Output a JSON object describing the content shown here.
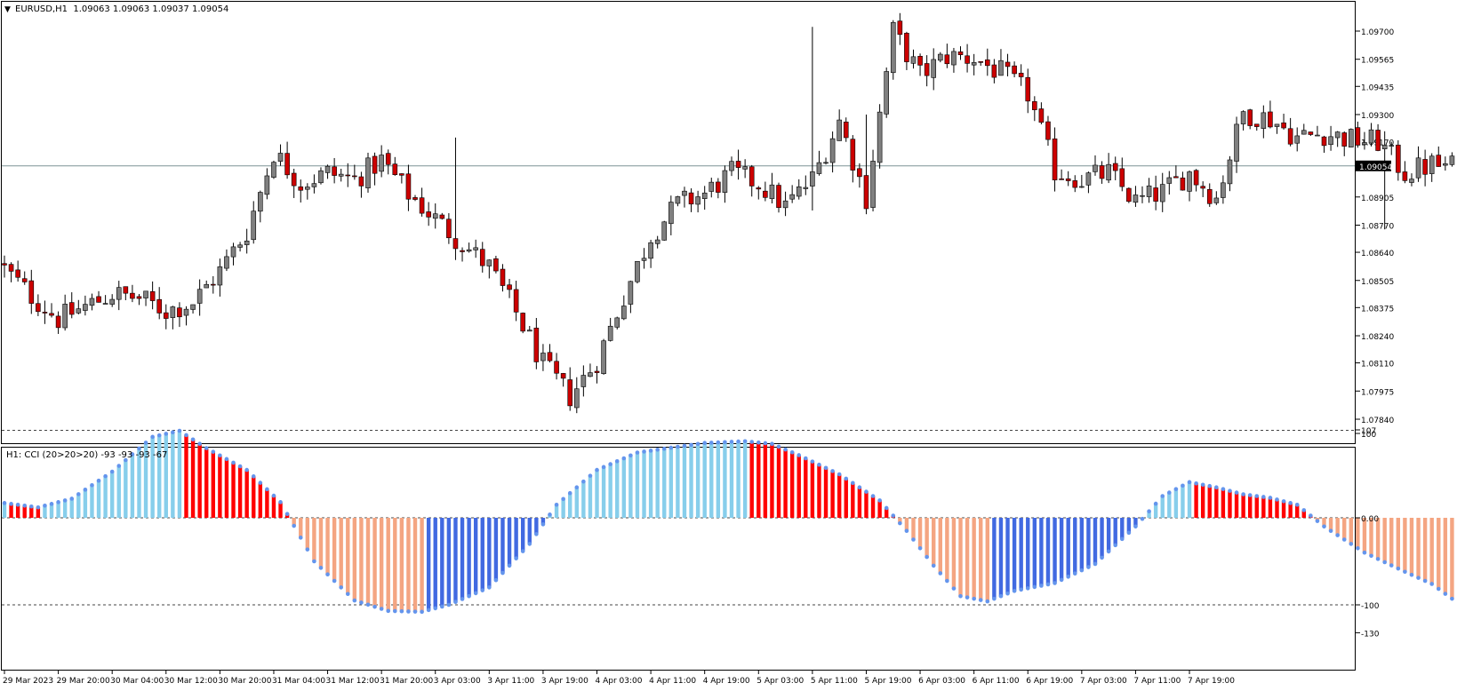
{
  "header": {
    "symbol_line": "EURUSD,H1  1.09063 1.09063 1.09037 1.09054",
    "dropdown_glyph": "▼"
  },
  "indicator_header": "H1: CCI (20>20>20) -93 -93 -93 -67",
  "colors": {
    "background": "#ffffff",
    "frame": "#000000",
    "bull_candle": "#808080",
    "bear_candle": "#cc0000",
    "wick": "#000000",
    "price_line": "#7f9396",
    "price_tag_bg": "#000000",
    "price_tag_fg": "#ffffff",
    "cci_bull_above": "#87ceeb",
    "cci_bear_above": "#ff0000",
    "cci_bear_below": "#f4a582",
    "cci_bull_below": "#4169e1",
    "cci_dot": "#6495ed",
    "level_line": "#444444"
  },
  "chart_data": [
    {
      "type": "candlestick",
      "title": "EURUSD,H1",
      "ohlc_header": [
        1.09063,
        1.09063,
        1.09037,
        1.09054
      ],
      "current_price": 1.09054,
      "current_price_label": "1.09054",
      "ylim": [
        1.0784,
        1.0975
      ],
      "y_tick_labels": [
        "1.09700",
        "1.09565",
        "1.09435",
        "1.09300",
        "1.09170",
        "1.08905",
        "1.08770",
        "1.08640",
        "1.08505",
        "1.08375",
        "1.08240",
        "1.08110",
        "1.07975",
        "1.07840"
      ],
      "y_ticks": [
        1.097,
        1.09565,
        1.09435,
        1.093,
        1.0917,
        1.08905,
        1.0877,
        1.0864,
        1.08505,
        1.08375,
        1.0824,
        1.0811,
        1.07975,
        1.0784
      ],
      "close_path": [
        [
          0,
          1.0856
        ],
        [
          4,
          1.0843
        ],
        [
          8,
          1.0832
        ],
        [
          12,
          1.0838
        ],
        [
          16,
          1.0844
        ],
        [
          20,
          1.0842
        ],
        [
          24,
          1.0836
        ],
        [
          28,
          1.084
        ],
        [
          32,
          1.0855
        ],
        [
          36,
          1.0874
        ],
        [
          40,
          1.0912
        ],
        [
          44,
          1.0897
        ],
        [
          48,
          1.0902
        ],
        [
          52,
          1.0899
        ],
        [
          56,
          1.0908
        ],
        [
          60,
          1.0892
        ],
        [
          64,
          1.088
        ],
        [
          68,
          1.0868
        ],
        [
          72,
          1.0857
        ],
        [
          76,
          1.0835
        ],
        [
          80,
          1.081
        ],
        [
          84,
          1.0795
        ],
        [
          88,
          1.0812
        ],
        [
          92,
          1.0843
        ],
        [
          96,
          1.0872
        ],
        [
          100,
          1.0887
        ],
        [
          104,
          1.0892
        ],
        [
          108,
          1.0902
        ],
        [
          112,
          1.0897
        ],
        [
          116,
          1.0886
        ],
        [
          120,
          1.0899
        ],
        [
          124,
          1.0927
        ],
        [
          128,
          1.089
        ],
        [
          132,
          1.097
        ],
        [
          136,
          1.0949
        ],
        [
          140,
          1.0958
        ],
        [
          144,
          1.0957
        ],
        [
          148,
          1.095
        ],
        [
          152,
          1.094
        ],
        [
          156,
          1.0903
        ],
        [
          160,
          1.0899
        ],
        [
          164,
          1.0902
        ],
        [
          168,
          1.0888
        ],
        [
          172,
          1.0893
        ],
        [
          176,
          1.0902
        ],
        [
          180,
          1.089
        ],
        [
          184,
          1.0931
        ],
        [
          188,
          1.0928
        ],
        [
          192,
          1.0919
        ],
        [
          196,
          1.0921
        ],
        [
          200,
          1.0918
        ],
        [
          204,
          1.0917
        ],
        [
          208,
          1.0902
        ],
        [
          212,
          1.0906
        ],
        [
          215,
          1.0905
        ]
      ],
      "wick_spikes": [
        {
          "bar": 67,
          "low": 1.0875,
          "high": 1.0919
        },
        {
          "bar": 120,
          "low": 1.0884,
          "high": 1.0972
        },
        {
          "bar": 128,
          "low": 1.0885,
          "high": 1.093
        },
        {
          "bar": 205,
          "low": 1.0875,
          "high": 1.0922
        }
      ]
    },
    {
      "type": "histogram",
      "title": "CCI (20>20>20)",
      "legend_values": [
        -93,
        -93,
        -93,
        -67
      ],
      "ylim": [
        -130,
        100
      ],
      "y_tick_labels": [
        "107",
        "100",
        "0.00",
        "-100",
        "-130"
      ],
      "y_ticks": [
        107,
        100,
        0,
        -100,
        -130
      ],
      "levels": [
        100,
        0,
        -100
      ],
      "cci_path": [
        [
          0,
          17
        ],
        [
          5,
          12
        ],
        [
          10,
          22
        ],
        [
          16,
          53
        ],
        [
          22,
          93
        ],
        [
          26,
          100
        ],
        [
          30,
          80
        ],
        [
          36,
          55
        ],
        [
          41,
          18
        ],
        [
          46,
          -50
        ],
        [
          52,
          -95
        ],
        [
          57,
          -107
        ],
        [
          62,
          -108
        ],
        [
          66,
          -100
        ],
        [
          72,
          -80
        ],
        [
          78,
          -30
        ],
        [
          82,
          15
        ],
        [
          88,
          55
        ],
        [
          94,
          75
        ],
        [
          104,
          86
        ],
        [
          110,
          88
        ],
        [
          114,
          85
        ],
        [
          118,
          72
        ],
        [
          124,
          50
        ],
        [
          130,
          20
        ],
        [
          134,
          -15
        ],
        [
          138,
          -55
        ],
        [
          142,
          -90
        ],
        [
          146,
          -96
        ],
        [
          150,
          -84
        ],
        [
          156,
          -75
        ],
        [
          162,
          -53
        ],
        [
          168,
          -10
        ],
        [
          172,
          25
        ],
        [
          176,
          41
        ],
        [
          180,
          35
        ],
        [
          184,
          27
        ],
        [
          188,
          23
        ],
        [
          192,
          15
        ],
        [
          196,
          -10
        ],
        [
          202,
          -40
        ],
        [
          208,
          -62
        ],
        [
          212,
          -76
        ],
        [
          215,
          -93
        ]
      ]
    }
  ],
  "x_axis": {
    "labels": [
      "29 Mar 2023",
      "29 Mar 20:00",
      "30 Mar 04:00",
      "30 Mar 12:00",
      "30 Mar 20:00",
      "31 Mar 04:00",
      "31 Mar 12:00",
      "31 Mar 20:00",
      "3 Apr 03:00",
      "3 Apr 11:00",
      "3 Apr 19:00",
      "4 Apr 03:00",
      "4 Apr 11:00",
      "4 Apr 19:00",
      "5 Apr 03:00",
      "5 Apr 11:00",
      "5 Apr 19:00",
      "6 Apr 03:00",
      "6 Apr 11:00",
      "6 Apr 19:00",
      "7 Apr 03:00",
      "7 Apr 11:00",
      "7 Apr 19:00"
    ],
    "bars_per_label": 8,
    "bar_count": 216
  }
}
